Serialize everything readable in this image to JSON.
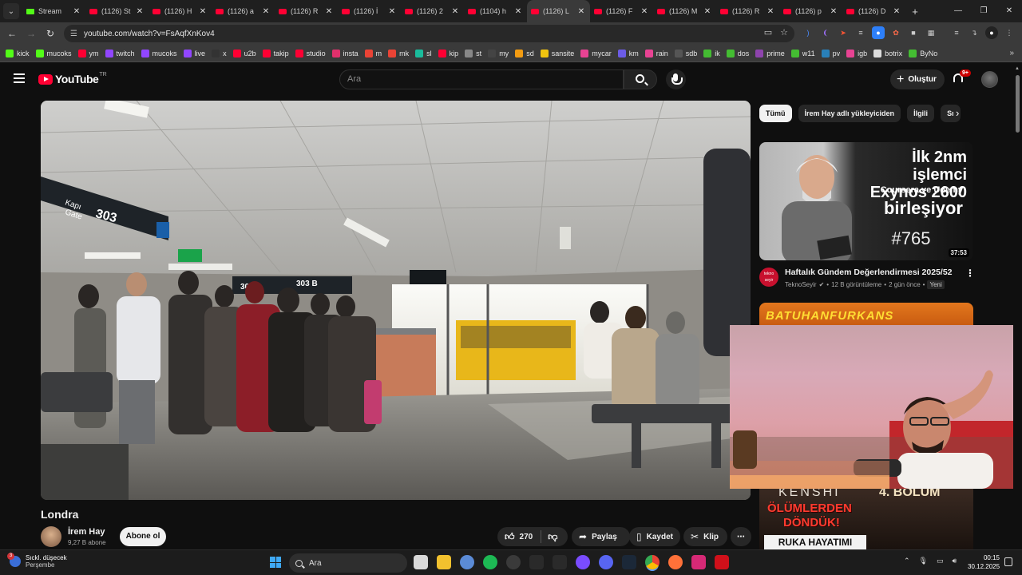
{
  "browser": {
    "tabs": [
      {
        "title": "Stream",
        "icon": "kick-favicon"
      },
      {
        "title": "(1126) St",
        "icon": "youtube-favicon"
      },
      {
        "title": "(1126) H",
        "icon": "youtube-favicon"
      },
      {
        "title": "(1126) a",
        "icon": "youtube-favicon"
      },
      {
        "title": "(1126) R",
        "icon": "youtube-favicon"
      },
      {
        "title": "(1126) İ",
        "icon": "youtube-favicon"
      },
      {
        "title": "(1126) 2",
        "icon": "youtube-favicon"
      },
      {
        "title": "(1104) h",
        "icon": "youtube-favicon"
      },
      {
        "title": "(1126) L",
        "icon": "youtube-favicon"
      },
      {
        "title": "(1126) F",
        "icon": "youtube-favicon"
      },
      {
        "title": "(1126) M",
        "icon": "youtube-favicon"
      },
      {
        "title": "(1126) R",
        "icon": "youtube-favicon"
      },
      {
        "title": "(1126) p",
        "icon": "youtube-favicon"
      },
      {
        "title": "(1126) D",
        "icon": "youtube-favicon"
      }
    ],
    "active_tab": 8,
    "url": "youtube.com/watch?v=FsAqfXnKov4",
    "bookmarks": [
      {
        "label": "kick",
        "color": "#53fc18"
      },
      {
        "label": "mucoks",
        "color": "#53fc18"
      },
      {
        "label": "ym",
        "color": "#ff0033"
      },
      {
        "label": "twitch",
        "color": "#9146ff"
      },
      {
        "label": "mucoks",
        "color": "#9146ff"
      },
      {
        "label": "live",
        "color": "#9146ff"
      },
      {
        "label": "x",
        "color": "#333333"
      },
      {
        "label": "u2b",
        "color": "#ff0033"
      },
      {
        "label": "takip",
        "color": "#ff0033"
      },
      {
        "label": "studio",
        "color": "#ff0033"
      },
      {
        "label": "insta",
        "color": "#e1306c"
      },
      {
        "label": "m",
        "color": "#ea4335"
      },
      {
        "label": "mk",
        "color": "#ea4335"
      },
      {
        "label": "sl",
        "color": "#1abc9c"
      },
      {
        "label": "kip",
        "color": "#ff0033"
      },
      {
        "label": "st",
        "color": "#888888"
      },
      {
        "label": "my",
        "color": "#444444"
      },
      {
        "label": "sd",
        "color": "#f39c12"
      },
      {
        "label": "sansite",
        "color": "#f1c40f"
      },
      {
        "label": "mycar",
        "color": "#e84393"
      },
      {
        "label": "km",
        "color": "#6c5ce7"
      },
      {
        "label": "rain",
        "color": "#e84393"
      },
      {
        "label": "sdb",
        "color": "#555555"
      },
      {
        "label": "ik",
        "color": "#44bd32"
      },
      {
        "label": "dos",
        "color": "#44bd32"
      },
      {
        "label": "prime",
        "color": "#8e44ad"
      },
      {
        "label": "w11",
        "color": "#44bd32"
      },
      {
        "label": "pv",
        "color": "#2980b9"
      },
      {
        "label": "igb",
        "color": "#e84393"
      },
      {
        "label": "botrix",
        "color": "#dddddd"
      },
      {
        "label": "ByNo",
        "color": "#44bd32"
      }
    ]
  },
  "youtube": {
    "logo_text": "YouTube",
    "logo_region": "TR",
    "search_placeholder": "Ara",
    "create_label": "Oluştur",
    "notif_badge": "9+"
  },
  "video": {
    "title": "Londra",
    "channel": "İrem Hay",
    "subscribers": "9,27 B abone",
    "subscribe_label": "Abone ol",
    "likes": "270",
    "share_label": "Paylaş",
    "save_label": "Kaydet",
    "clip_label": "Klip",
    "scene_signs": {
      "kapi": "Kapı",
      "gate": "Gate",
      "gate_no": "303",
      "gate_303a": "303 A",
      "gate_303b": "303 B"
    }
  },
  "sidebar": {
    "chips": [
      "Tümü",
      "İrem Hay adlı yükleyiciden",
      "İlgili",
      "Sı"
    ],
    "rec1": {
      "thumb_lines": [
        "İlk 2nm işlemci",
        "Exynos 2600",
        "Coursera ve Udemy",
        "birleşiyor",
        "#765"
      ],
      "duration": "37:53",
      "channel_icon_text": "tekno seyir",
      "title": "Haftalık Gündem Değerlendirmesi 2025/52",
      "channel": "TeknoSeyir",
      "views": "12 B görüntüleme",
      "age": "2 gün önce",
      "badge": "Yeni"
    },
    "rec2": {
      "thumb_text": "BATUHANFURKANS"
    },
    "rec3": {
      "thumb_lines": [
        "KENSHI",
        "4. BÖLÜM",
        "ÖLÜMLERDEN",
        "DÖNDÜK!",
        "RUKA HAYATIMI"
      ]
    }
  },
  "taskbar": {
    "weather_line1": "Sıckl. düşecek",
    "weather_line2": "Perşembe",
    "weather_badge": "3",
    "search_label": "Ara",
    "time": "00:15",
    "date": "30.12.2025"
  }
}
